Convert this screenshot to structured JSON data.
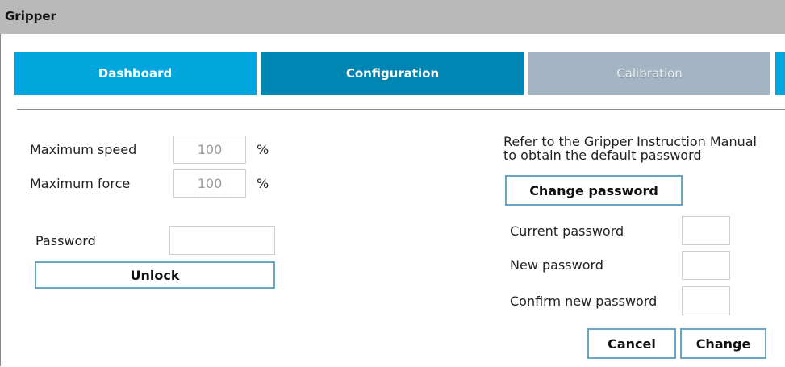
{
  "window": {
    "title": "Gripper"
  },
  "tabs": [
    {
      "label": "Dashboard",
      "state": "normal"
    },
    {
      "label": "Configuration",
      "state": "active"
    },
    {
      "label": "Calibration",
      "state": "disabled"
    }
  ],
  "settings": {
    "max_speed": {
      "label": "Maximum speed",
      "value": "100",
      "unit": "%"
    },
    "max_force": {
      "label": "Maximum force",
      "value": "100",
      "unit": "%"
    },
    "password": {
      "label": "Password",
      "value": ""
    },
    "unlock_label": "Unlock"
  },
  "password_panel": {
    "info_line1": "Refer to the Gripper Instruction Manual",
    "info_line2": "to obtain the default password",
    "change_password_label": "Change password",
    "current_password_label": "Current password",
    "new_password_label": "New password",
    "confirm_password_label": "Confirm new password",
    "cancel_label": "Cancel",
    "change_label": "Change"
  },
  "colors": {
    "tab_blue": "#00a6dc",
    "tab_active": "#0086b3",
    "tab_disabled": "#a4b4c2",
    "button_border": "#6aa7c6"
  }
}
